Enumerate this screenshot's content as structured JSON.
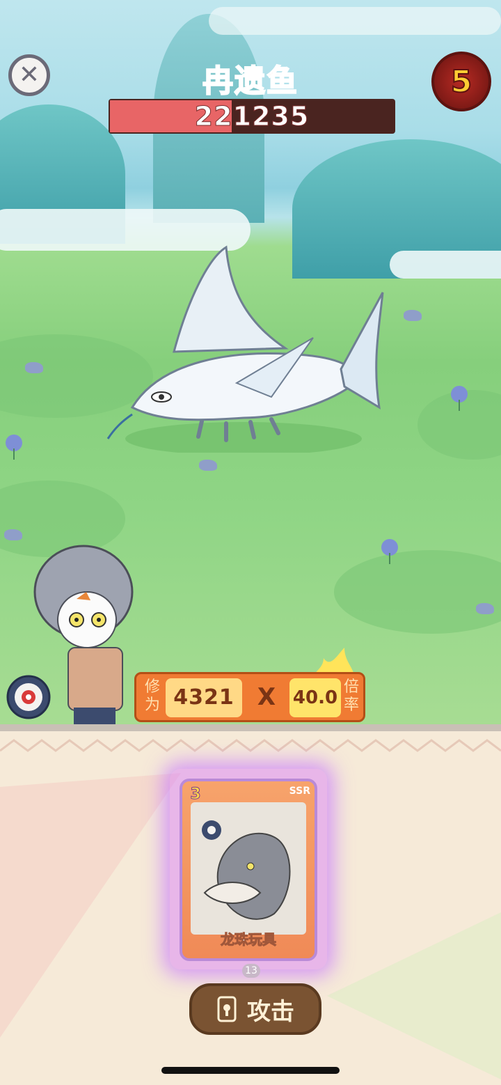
{
  "boss": {
    "name": "冉遗鱼",
    "hp_text": "221235",
    "hp_fraction": 0.43
  },
  "round": {
    "value": "5"
  },
  "power": {
    "label_left": "修为",
    "value": "4321",
    "times": "X",
    "multiplier": "40.0",
    "label_right": "倍率"
  },
  "card": {
    "level": "3",
    "rarity": "SSR",
    "name": "龙珠玩具",
    "count": "13"
  },
  "attack_button": {
    "label": "攻击"
  },
  "colors": {
    "hp_fill": "#e86566",
    "hp_bg": "#4a2420",
    "power_panel": "#f07b33",
    "card_glow": "#c878ff",
    "button": "#7a5332"
  }
}
